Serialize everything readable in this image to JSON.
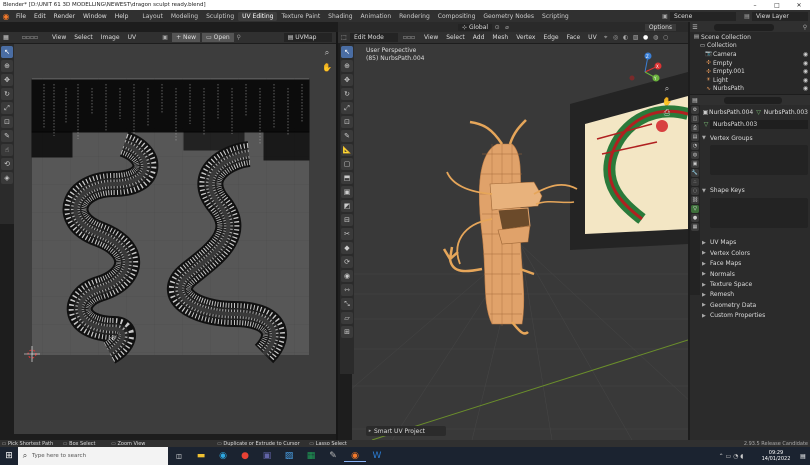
{
  "titlebar": {
    "title": "Blender* [D:\\UNIT 61 3D MODELLING\\NEWEST\\dragon sculpt ready.blend]"
  },
  "menubar": {
    "menus": [
      "File",
      "Edit",
      "Render",
      "Window",
      "Help"
    ],
    "workspaces": [
      "Layout",
      "Modeling",
      "Sculpting",
      "UV Editing",
      "Texture Paint",
      "Shading",
      "Animation",
      "Rendering",
      "Compositing",
      "Geometry Nodes",
      "Scripting"
    ],
    "active_workspace": "UV Editing",
    "scene": "Scene",
    "view_layer": "View Layer"
  },
  "uv_editor": {
    "menus": [
      "View",
      "Select",
      "Image",
      "UV"
    ],
    "new_label": "New",
    "open_label": "Open",
    "uvmap_label": "UVMap"
  },
  "viewport": {
    "mode": "Edit Mode",
    "menus": [
      "View",
      "Select",
      "Add",
      "Mesh",
      "Vertex",
      "Edge",
      "Face",
      "UV"
    ],
    "orientation": "Global",
    "options_label": "Options",
    "perspective_label": "User Perspective",
    "object_label": "(85) NurbsPath.004",
    "last_operator": "Smart UV Project",
    "gizmo_axes": {
      "x": "X",
      "y": "Y",
      "z": "Z"
    }
  },
  "outliner": {
    "items": [
      {
        "label": "Scene Collection",
        "icon": "scene-collection-icon",
        "indent": 0
      },
      {
        "label": "Collection",
        "icon": "collection-icon",
        "indent": 1
      },
      {
        "label": "Camera",
        "icon": "camera-icon",
        "indent": 2
      },
      {
        "label": "Empty",
        "icon": "empty-icon",
        "indent": 2
      },
      {
        "label": "Empty.001",
        "icon": "empty-icon",
        "indent": 2
      },
      {
        "label": "Light",
        "icon": "light-icon",
        "indent": 2
      },
      {
        "label": "NurbsPath",
        "icon": "curve-icon",
        "indent": 2
      }
    ]
  },
  "properties": {
    "object_name": "NurbsPath.004",
    "data_name": "NurbsPath.003",
    "datablock": "NurbsPath.003",
    "sections": [
      "Vertex Groups",
      "Shape Keys",
      "UV Maps",
      "Vertex Colors",
      "Face Maps",
      "Normals",
      "Texture Space",
      "Remesh",
      "Geometry Data",
      "Custom Properties"
    ]
  },
  "statusbar": {
    "hints": [
      "Pick Shortest Path",
      "Box Select",
      "Zoom View",
      "Duplicate or Extrude to Cursor",
      "Lasso Select"
    ],
    "version": "2.93.5 Release Candidate"
  },
  "taskbar": {
    "search_placeholder": "Type here to search",
    "time": "09:29",
    "date": "14/01/2022"
  },
  "colors": {
    "accent": "#4a6da3",
    "object_orange": "#e0a26a",
    "selection_yellow": "#f0a030",
    "dragon_green": "#2a7a3a",
    "dragon_red": "#b02020",
    "taskbar_bg": "#1b2330"
  }
}
